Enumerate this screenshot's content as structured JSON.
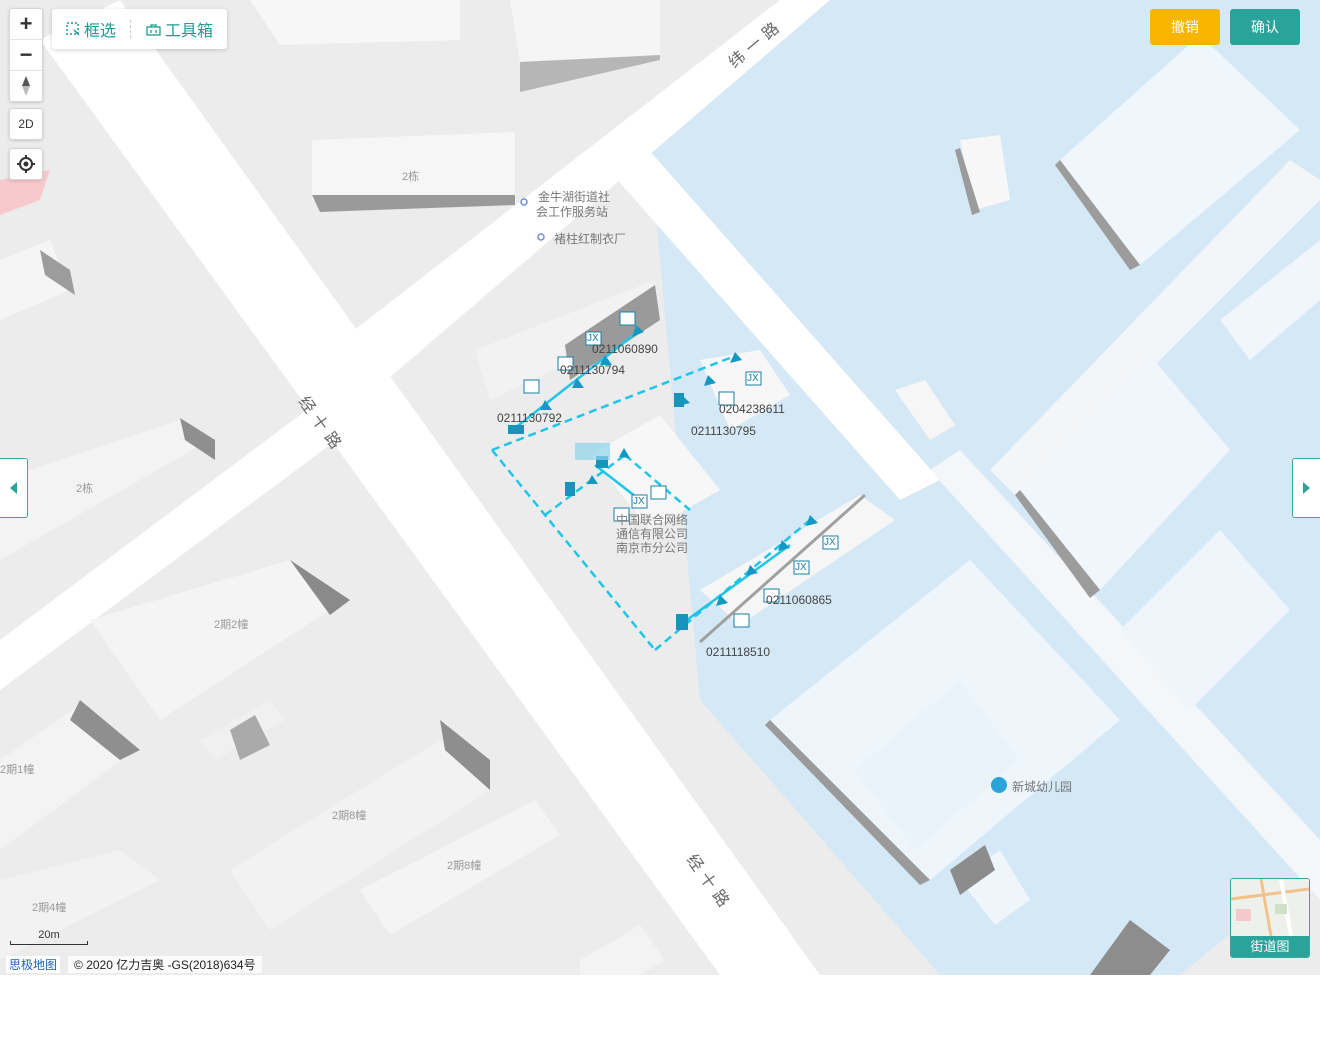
{
  "toolbar": {
    "select_label": "框选",
    "toolbox_label": "工具箱"
  },
  "zoom": {
    "zoom_in": "+",
    "zoom_out": "−",
    "mode_2d": "2D"
  },
  "actions": {
    "undo_label": "撤销",
    "confirm_label": "确认",
    "undo_color": "#f7b500",
    "confirm_color": "#2aa39a"
  },
  "map_labels": {
    "roads": [
      "纬一路",
      "经十路",
      "经十路"
    ],
    "pois": {
      "poi_1_line1": "金牛湖街道社",
      "poi_1_line2": "会工作服务站",
      "poi_2": "褚柱红制衣厂",
      "poi_3_line1": "中国联合网络",
      "poi_3_line2": "通信有限公司",
      "poi_3_line3": "南京市分公司",
      "poi_4": "新城幼儿园"
    },
    "buildings": [
      "2栋",
      "2栋",
      "2期2幢",
      "2期1幢",
      "2期8幢",
      "2期8幢",
      "2期4幢"
    ],
    "well_ids": [
      "0211060890",
      "0211130794",
      "0211130792",
      "0204238611",
      "0211130795",
      "0211060865",
      "0211118510"
    ],
    "marker_text": "JX"
  },
  "street_view": {
    "label": "街道图"
  },
  "scale": {
    "label": "20m"
  },
  "attribution": {
    "logo": "思极地图",
    "copyright": "© 2020 亿力吉奥 -GS(2018)634号"
  },
  "colors": {
    "pipeline": "#1ec5e8",
    "water": "#d5e8f5",
    "accent": "#2aa39a"
  },
  "icons": {
    "select": "dashed-box-select-icon",
    "toolbox": "toolbox-icon",
    "compass": "compass-icon",
    "locate": "locate-icon",
    "left": "chevron-left-icon",
    "right": "chevron-right-icon"
  }
}
